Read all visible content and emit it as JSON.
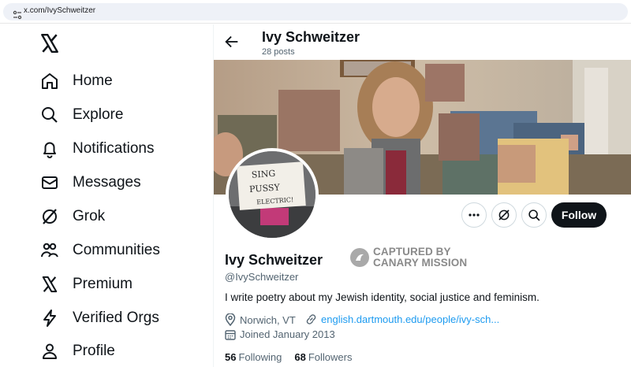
{
  "browser": {
    "url": "x.com/IvySchweitzer"
  },
  "nav": {
    "items": [
      {
        "label": "Home",
        "icon": "home-icon"
      },
      {
        "label": "Explore",
        "icon": "search-icon"
      },
      {
        "label": "Notifications",
        "icon": "bell-icon"
      },
      {
        "label": "Messages",
        "icon": "mail-icon"
      },
      {
        "label": "Grok",
        "icon": "grok-icon"
      },
      {
        "label": "Communities",
        "icon": "people-icon"
      },
      {
        "label": "Premium",
        "icon": "x-logo-icon"
      },
      {
        "label": "Verified Orgs",
        "icon": "lightning-icon"
      },
      {
        "label": "Profile",
        "icon": "person-icon"
      }
    ]
  },
  "header": {
    "name": "Ivy Schweitzer",
    "posts": "28 posts"
  },
  "avatar_sign": {
    "line1": "SING",
    "line2": "PUSSY",
    "line3": "ELECTRIC!"
  },
  "actions": {
    "follow_label": "Follow"
  },
  "profile": {
    "name": "Ivy Schweitzer",
    "handle": "@IvySchweitzer",
    "bio": "I write poetry about my Jewish identity, social justice and feminism.",
    "location": "Norwich, VT",
    "website": "english.dartmouth.edu/people/ivy-sch...",
    "joined": "Joined January 2013",
    "following_count": "56",
    "following_label": "Following",
    "followers_count": "68",
    "followers_label": "Followers"
  },
  "watermark": {
    "line1": "CAPTURED BY",
    "line2": "CANARY MISSION"
  },
  "colors": {
    "text": "#0f1419",
    "muted": "#536471",
    "link": "#1d9bf0",
    "border": "#cfd9de"
  }
}
